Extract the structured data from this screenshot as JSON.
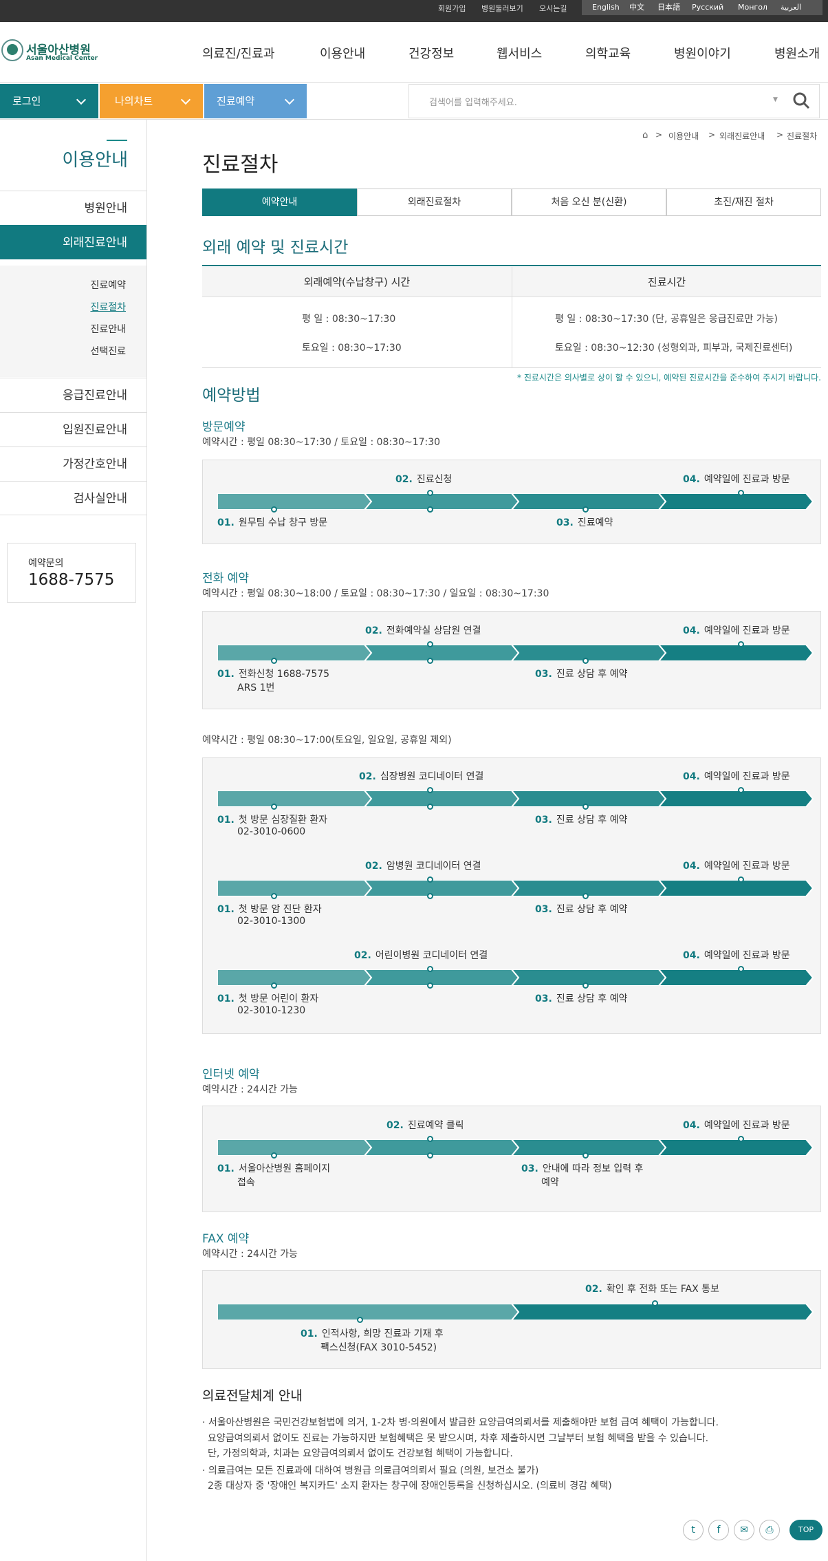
{
  "util": {
    "signup": "회원가입",
    "floor": "병원둘러보기",
    "directions": "오시는길"
  },
  "langs": [
    "English",
    "中文",
    "日本語",
    "Русский",
    "Монгол",
    "العربية"
  ],
  "logo": {
    "ko": "서울아산병원",
    "en": "Asan Medical Center"
  },
  "gnb": [
    "의료진/진료과",
    "이용안내",
    "건강정보",
    "웹서비스",
    "의학교육",
    "병원이야기",
    "병원소개"
  ],
  "quick": {
    "login": "로그인",
    "mychart": "나의차트",
    "reserve": "진료예약",
    "search_placeholder": "검색어를 입력해주세요."
  },
  "colors": {
    "teal": "#117a80",
    "orange": "#f5a02f",
    "blue": "#5f9fd5"
  },
  "sidebar": {
    "title": "이용안내",
    "items": [
      "병원안내",
      "외래진료안내",
      "응급진료안내",
      "입원진료안내",
      "가정간호안내",
      "검사실안내"
    ],
    "sub": [
      "진료예약",
      "진료절차",
      "진료안내",
      "선택진료"
    ],
    "phone_label": "예약문의",
    "phone": "1688-7575"
  },
  "breadcrumb": [
    "이용안내",
    "외래진료안내",
    "진료절차"
  ],
  "page_title": "진료절차",
  "tabs": [
    "예약안내",
    "외래진료절차",
    "처음 오신 분(신환)",
    "초진/재진 절차"
  ],
  "hours": {
    "title": "외래 예약 및 진료시간",
    "col1": "외래예약(수납창구) 시간",
    "col2": "진료시간",
    "r1c1": "평 일 : 08:30~17:30",
    "r2c1": "토요일 : 08:30~17:30",
    "r1c2": "평 일 : 08:30~17:30 (단, 공휴일은 응급진료만 가능)",
    "r2c2": "토요일 : 08:30~12:30 (성형외과, 피부과, 국제진료센터)",
    "note": "* 진료시간은 의사별로 상이 할 수 있으니, 예약된 진료시간을 준수하여 주시기 바랍니다."
  },
  "method_title": "예약방법",
  "visit": {
    "title": "방문예약",
    "time": "예약시간 : 평일 08:30~17:30 / 토요일 : 08:30~17:30",
    "s1": "원무팀 수납 창구 방문",
    "s2": "진료신청",
    "s3": "진료예약",
    "s4": "예약일에 진료과 방문"
  },
  "phone_res": {
    "title": "전화 예약",
    "time": "예약시간 : 평일 08:30~18:00 / 토요일 : 08:30~17:30 / 일요일 : 08:30~17:30",
    "s1": "전화신청 1688-7575",
    "s1b": "ARS 1번",
    "s2": "전화예약실 상담원 연결",
    "s3": "진료 상담 후 예약",
    "s4": "예약일에 진료과 방문"
  },
  "coord": {
    "time": "예약시간 : 평일 08:30~17:00(토요일, 일요일, 공휴일 제외)",
    "rows": [
      {
        "s1": "첫 방문 심장질환 환자",
        "s1b": "02-3010-0600",
        "s2": "심장병원 코디네이터 연결",
        "s3": "진료 상담 후 예약",
        "s4": "예약일에 진료과 방문"
      },
      {
        "s1": "첫 방문 암 진단 환자",
        "s1b": "02-3010-1300",
        "s2": "암병원 코디네이터 연결",
        "s3": "진료 상담 후 예약",
        "s4": "예약일에 진료과 방문"
      },
      {
        "s1": "첫 방문 어린이 환자",
        "s1b": "02-3010-1230",
        "s2": "어린이병원 코디네이터 연결",
        "s3": "진료 상담 후 예약",
        "s4": "예약일에 진료과 방문"
      }
    ]
  },
  "internet": {
    "title": "인터넷 예약",
    "time": "예약시간 : 24시간 가능",
    "s1": "서울아산병원 홈페이지",
    "s1b": "접속",
    "s2": "진료예약 클릭",
    "s3": "안내에 따라 정보 입력 후",
    "s3b": "예약",
    "s4": "예약일에 진료과 방문"
  },
  "fax": {
    "title": "FAX 예약",
    "time": "예약시간 : 24시간 가능",
    "s1": "인적사항, 희망 진료과 기재 후",
    "s1b": "팩스신청(FAX 3010-5452)",
    "s2": "확인 후 전화 또는 FAX 통보"
  },
  "nums": {
    "n1": "01.",
    "n2": "02.",
    "n3": "03.",
    "n4": "04."
  },
  "delivery": {
    "title": "의료전달체계 안내",
    "p1": "· 서울아산병원은 국민건강보험법에 의거, 1-2차 병·의원에서 발급한 요양급여의뢰서를 제출해야만 보험 급여 혜택이 가능합니다.",
    "p2": "요양급여의뢰서 없이도 진료는 가능하지만 보험혜택은 못 받으시며, 차후 제출하시면 그날부터 보험 혜택을 받을 수 있습니다.",
    "p3": "단, 가정의학과, 치과는 요양급여의뢰서 없이도 건강보험 혜택이 가능합니다.",
    "p4": "· 의료급여는 모든 진료과에 대하여 병원급 의료급여의뢰서 필요 (의원, 보건소 불가)",
    "p5": "2종 대상자 중 '장애인 복지카드' 소지 환자는 창구에 장애인등록을 신청하십시오. (의료비 경감 혜택)"
  },
  "top": "TOP"
}
